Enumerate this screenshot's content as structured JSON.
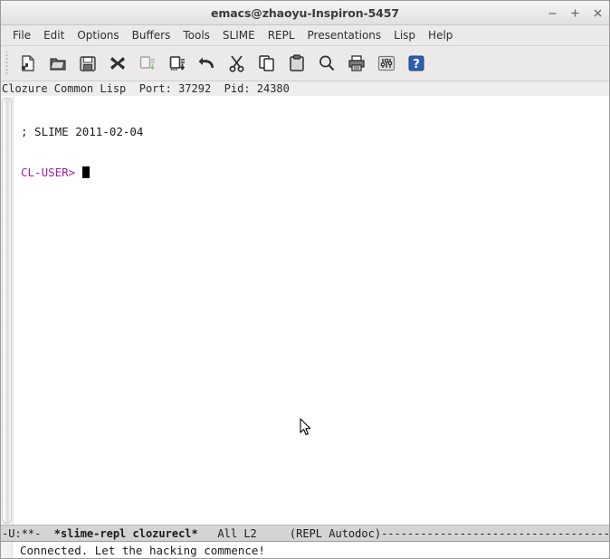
{
  "window": {
    "title": "emacs@zhaoyu-Inspiron-5457",
    "controls": [
      {
        "name": "minimize",
        "glyph": "minus"
      },
      {
        "name": "maximize",
        "glyph": "plus"
      },
      {
        "name": "close",
        "glyph": "cross"
      }
    ]
  },
  "menubar": {
    "items": [
      {
        "label": "File"
      },
      {
        "label": "Edit"
      },
      {
        "label": "Options"
      },
      {
        "label": "Buffers"
      },
      {
        "label": "Tools"
      },
      {
        "label": "SLIME"
      },
      {
        "label": "REPL"
      },
      {
        "label": "Presentations"
      },
      {
        "label": "Lisp"
      },
      {
        "label": "Help"
      }
    ]
  },
  "toolbar": {
    "items": [
      {
        "icon": "new-file-icon",
        "enabled": true
      },
      {
        "icon": "open-folder-icon",
        "enabled": true
      },
      {
        "icon": "save-disk-icon",
        "enabled": true
      },
      {
        "icon": "close-x-icon",
        "enabled": true
      },
      {
        "icon": "save-as-icon",
        "enabled": false
      },
      {
        "icon": "save-all-icon",
        "enabled": true
      },
      {
        "icon": "undo-arrow-icon",
        "enabled": true
      },
      {
        "icon": "cut-scissors-icon",
        "enabled": true
      },
      {
        "icon": "copy-icon",
        "enabled": true
      },
      {
        "icon": "paste-clipboard-icon",
        "enabled": true
      },
      {
        "icon": "search-magnifier-icon",
        "enabled": true
      },
      {
        "icon": "print-icon",
        "enabled": true
      },
      {
        "icon": "preferences-sliders-icon",
        "enabled": true
      },
      {
        "icon": "help-question-icon",
        "enabled": true
      }
    ]
  },
  "header_line": {
    "text": "Clozure Common Lisp  Port: 37292  Pid: 24380"
  },
  "buffer": {
    "lines": [
      {
        "text": "; SLIME 2011-02-04"
      }
    ],
    "prompt": "CL-USER> ",
    "prompt_color": "#a020a0",
    "input": ""
  },
  "mode_line": {
    "status": "-U:**-  ",
    "buffer_name": "*slime-repl clozurecl*",
    "position": "   All L2     ",
    "minor_mode": "(REPL Autodoc)",
    "filler": "-----------------------------------------------------------------"
  },
  "minibuffer": {
    "message": "Connected. Let the hacking commence!"
  }
}
